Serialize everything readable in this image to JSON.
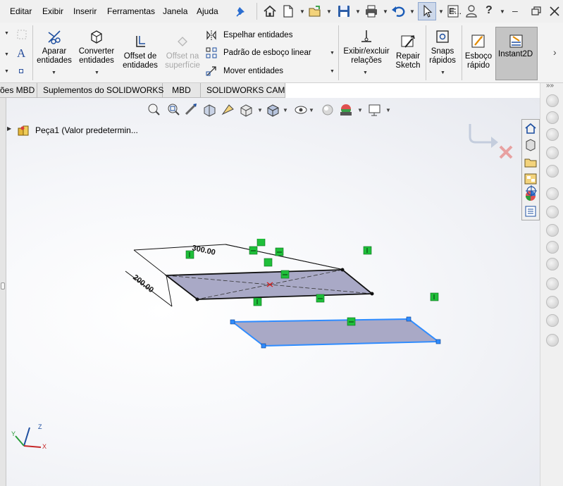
{
  "menu": {
    "items": [
      "Editar",
      "Exibir",
      "Inserir",
      "Ferramentas",
      "Janela",
      "Ajuda"
    ],
    "search_prefix": "E..."
  },
  "ribbon": {
    "aparar_line1": "Aparar",
    "aparar_line2": "entidades",
    "converter_line1": "Converter",
    "converter_line2": "entidades",
    "offset_line1": "Offset de",
    "offset_line2": "entidades",
    "offset_sup_line1": "Offset na",
    "offset_sup_line2": "superfície",
    "espelhar": "Espelhar entidades",
    "padrao": "Padrão de esboço linear",
    "mover": "Mover entidades",
    "exibir_line1": "Exibir/excluir",
    "exibir_line2": "relações",
    "repair_line1": "Repair",
    "repair_line2": "Sketch",
    "snaps_line1": "Snaps",
    "snaps_line2": "rápidos",
    "esboco_line1": "Esboço",
    "esboco_line2": "rápido",
    "instant2d": "Instant2D"
  },
  "tabs": [
    "ões MBD",
    "Suplementos do SOLIDWORKS",
    "MBD",
    "SOLIDWORKS CAM"
  ],
  "tree": {
    "part_label": "Peça1  (Valor predetermin..."
  },
  "dimensions": {
    "length": "300.00",
    "width": "200.00"
  },
  "triad": {
    "z": "Z",
    "y": "Y",
    "x": "X"
  },
  "colors": {
    "accent": "#1a73e8",
    "selected_sketch": "#2f8cff",
    "relation_green": "#1fbf3a",
    "plane_fill": "#a9a9c6"
  }
}
